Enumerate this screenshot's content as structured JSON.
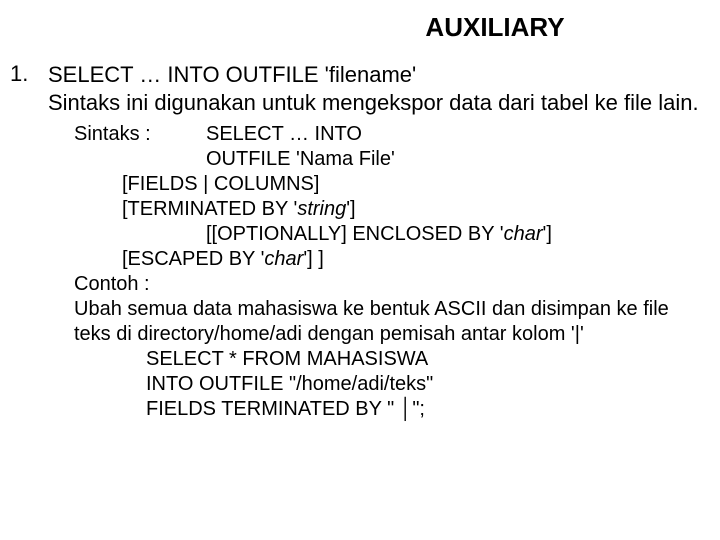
{
  "title": "AUXILIARY",
  "list_number": "1.",
  "stmt_line1": "SELECT … INTO OUTFILE 'filename'",
  "stmt_line2": "Sintaks ini digunakan untuk mengekspor data dari tabel ke file lain.",
  "syntax_label": "Sintaks  :",
  "syn_l1": "SELECT … INTO",
  "syn_l2": "OUTFILE 'Nama File'",
  "syn_l3": "[FIELDS | COLUMNS]",
  "syn_l4a": "[TERMINATED BY '",
  "syn_l4b": "string",
  "syn_l4c": "']",
  "syn_l5a": "[[OPTIONALLY] ENCLOSED BY '",
  "syn_l5b": "char",
  "syn_l5c": "']",
  "syn_l6a": "[ESCAPED BY '",
  "syn_l6b": "char",
  "syn_l6c": "'] ]",
  "contoh_label": "Contoh :",
  "contoh_text": "Ubah semua data mahasiswa ke bentuk ASCII dan disimpan ke file teks di directory/home/adi dengan pemisah antar kolom '|'",
  "ex_l1": "SELECT * FROM MAHASISWA",
  "ex_l2": "INTO OUTFILE \"/home/adi/teks\"",
  "ex_l3": "FIELDS TERMINATED BY \" │\";"
}
